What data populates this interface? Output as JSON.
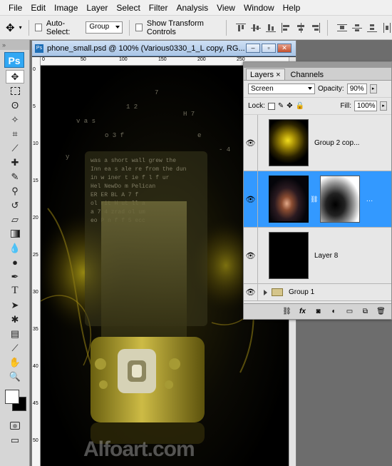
{
  "menu": [
    "File",
    "Edit",
    "Image",
    "Layer",
    "Select",
    "Filter",
    "Analysis",
    "View",
    "Window",
    "Help"
  ],
  "options": {
    "auto_select_label": "Auto-Select:",
    "auto_select_value": "Group",
    "transform_label": "Show Transform Controls"
  },
  "toolbox": {
    "logo": "Ps"
  },
  "document": {
    "title": "phone_small.psd @ 100% (Various0330_1_L copy, RG...",
    "ruler_top": [
      "0",
      "50",
      "100",
      "150",
      "200",
      "250"
    ],
    "ruler_left": [
      "0",
      "5",
      "10",
      "15",
      "20",
      "25",
      "30",
      "35",
      "40",
      "45",
      "50"
    ],
    "watermark": "Alfoart.com"
  },
  "layers_panel": {
    "tabs": [
      "Layers",
      "Channels"
    ],
    "blend_mode": "Screen",
    "opacity_label": "Opacity:",
    "opacity": "90%",
    "lock_label": "Lock:",
    "fill_label": "Fill:",
    "fill": "100%",
    "layers": [
      {
        "name": "Group 2 cop..."
      },
      {
        "name": ""
      },
      {
        "name": "Layer 8"
      }
    ],
    "group": "Group 1",
    "footer_icons": [
      "link-icon",
      "fx-icon",
      "mask-icon",
      "adjustment-icon",
      "folder-icon",
      "new-layer-icon",
      "trash-icon"
    ]
  },
  "colors": {
    "selection": "#3399ff",
    "ps_logo": "#31a8f4"
  }
}
